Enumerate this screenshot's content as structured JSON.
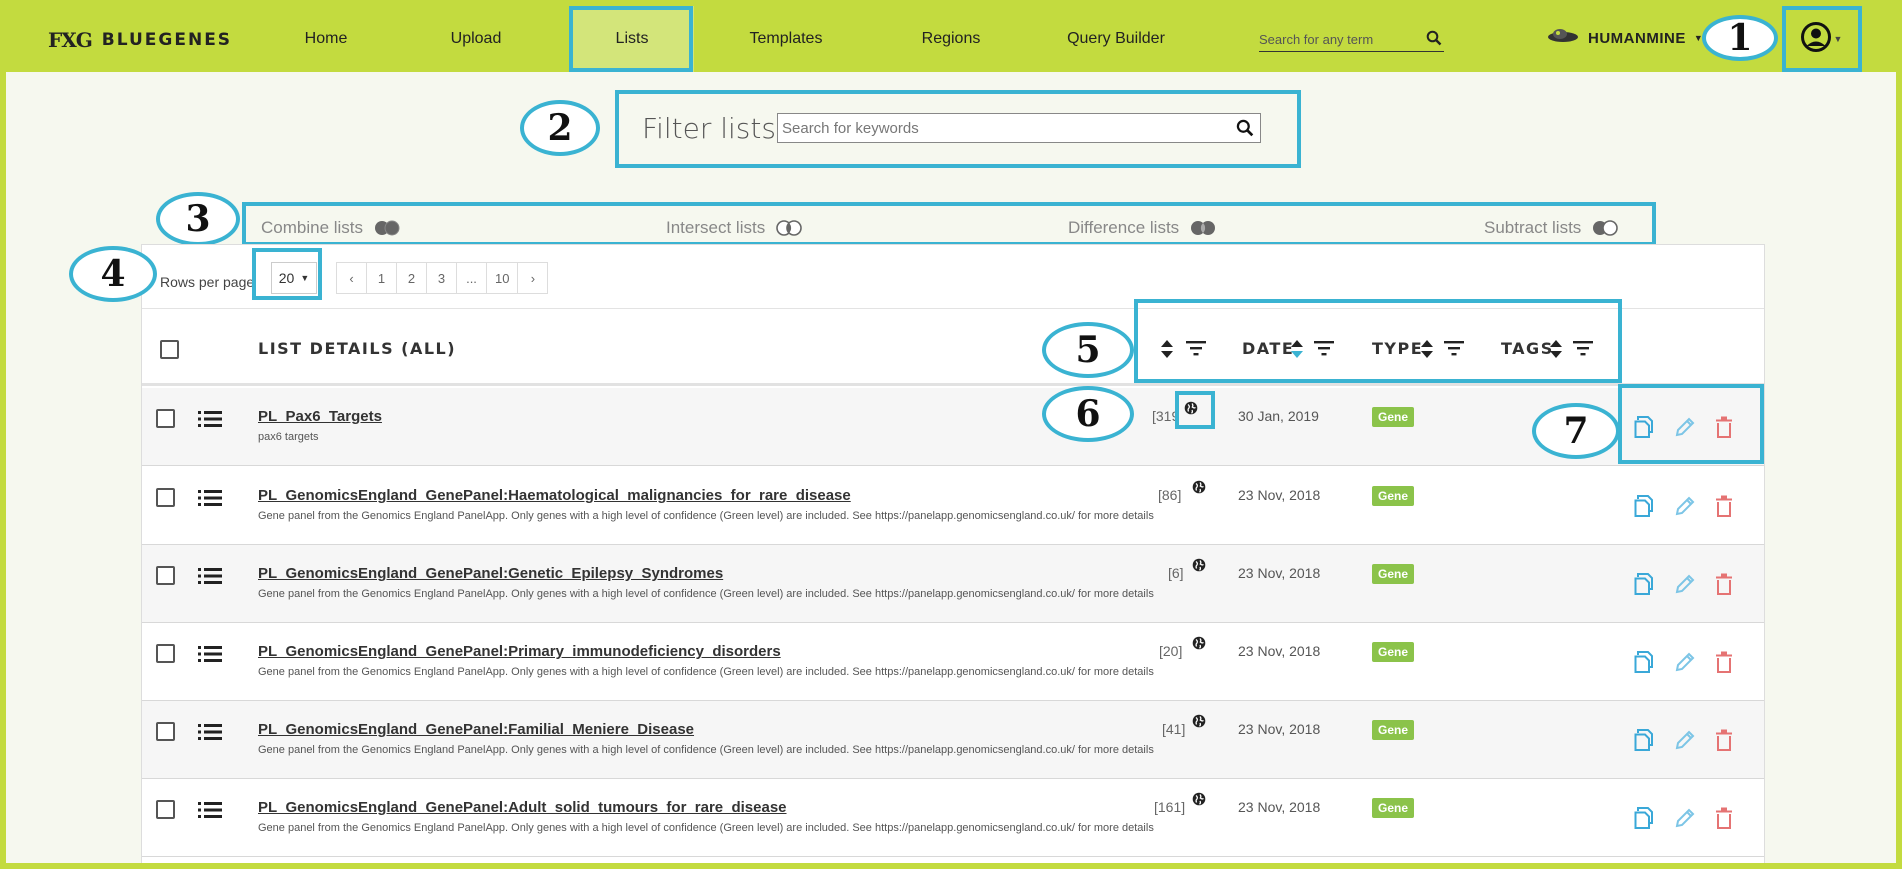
{
  "brand": {
    "name": "BLUEGENES",
    "mark": "FXG"
  },
  "nav": {
    "items": [
      {
        "label": "Home"
      },
      {
        "label": "Upload"
      },
      {
        "label": "Lists"
      },
      {
        "label": "Templates"
      },
      {
        "label": "Regions"
      },
      {
        "label": "Query Builder"
      }
    ],
    "active": "Lists",
    "search_placeholder": "Search for any term",
    "mine_name": "HUMANMINE"
  },
  "callouts": [
    "1",
    "2",
    "3",
    "4",
    "5",
    "6",
    "7"
  ],
  "filter": {
    "title": "Filter lists",
    "placeholder": "Search for keywords"
  },
  "set_ops": [
    "Combine lists",
    "Intersect lists",
    "Difference lists",
    "Subtract lists"
  ],
  "pagination": {
    "rows_label": "Rows per page",
    "rows_value": "20",
    "pages": [
      "‹",
      "1",
      "2",
      "3",
      "...",
      "10",
      "›"
    ]
  },
  "table": {
    "headers": {
      "details": "LIST DETAILS (ALL)",
      "date": "DATE",
      "type": "TYPE",
      "tags": "TAGS"
    },
    "rows": [
      {
        "title": "PL_Pax6_Targets",
        "desc": "pax6 targets",
        "count": "[319",
        "date": "30 Jan, 2019",
        "type": "Gene"
      },
      {
        "title": "PL_GenomicsEngland_GenePanel:Haematological_malignancies_for_rare_disease",
        "desc": "Gene panel from the Genomics England PanelApp. Only genes with a high level of confidence (Green level) are included. See https://panelapp.genomicsengland.co.uk/ for more details",
        "count": "[86]",
        "date": "23 Nov, 2018",
        "type": "Gene"
      },
      {
        "title": "PL_GenomicsEngland_GenePanel:Genetic_Epilepsy_Syndromes",
        "desc": "Gene panel from the Genomics England PanelApp. Only genes with a high level of confidence (Green level) are included. See https://panelapp.genomicsengland.co.uk/ for more details",
        "count": "[6]",
        "date": "23 Nov, 2018",
        "type": "Gene"
      },
      {
        "title": "PL_GenomicsEngland_GenePanel:Primary_immunodeficiency_disorders",
        "desc": "Gene panel from the Genomics England PanelApp. Only genes with a high level of confidence (Green level) are included. See https://panelapp.genomicsengland.co.uk/ for more details",
        "count": "[20]",
        "date": "23 Nov, 2018",
        "type": "Gene"
      },
      {
        "title": "PL_GenomicsEngland_GenePanel:Familial_Meniere_Disease",
        "desc": "Gene panel from the Genomics England PanelApp. Only genes with a high level of confidence (Green level) are included. See https://panelapp.genomicsengland.co.uk/ for more details",
        "count": "[41]",
        "date": "23 Nov, 2018",
        "type": "Gene"
      },
      {
        "title": "PL_GenomicsEngland_GenePanel:Adult_solid_tumours_for_rare_disease",
        "desc": "Gene panel from the Genomics England PanelApp. Only genes with a high level of confidence (Green level) are included. See https://panelapp.genomicsengland.co.uk/ for more details",
        "count": "[161]",
        "date": "23 Nov, 2018",
        "type": "Gene"
      }
    ]
  },
  "colors": {
    "nav_bg": "#c3db3f",
    "nav_active": "#d3e57a",
    "callout": "#3ab3d2",
    "badge": "#8bc34a",
    "copy_icon": "#3aa8d8",
    "edit_icon": "#7cc5e6",
    "delete_icon": "#e57373"
  },
  "icons": [
    "search-icon",
    "mine-logo-icon",
    "user-icon",
    "toggle-icon",
    "list-icon",
    "globe-icon",
    "copy-icon",
    "edit-icon",
    "delete-icon",
    "sort-icon",
    "filter-icon"
  ]
}
